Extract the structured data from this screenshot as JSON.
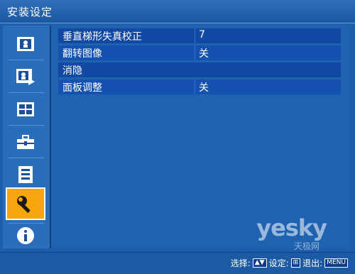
{
  "window": {
    "title": "安装设定"
  },
  "sidebar": {
    "items": [
      {
        "icon": "picture-icon",
        "active": false
      },
      {
        "icon": "picture-adjust-icon",
        "active": false
      },
      {
        "icon": "screen-split-icon",
        "active": false
      },
      {
        "icon": "toolbox-icon",
        "active": false
      },
      {
        "icon": "list-icon",
        "active": false
      },
      {
        "icon": "wrench-icon",
        "active": true
      },
      {
        "icon": "info-icon",
        "active": false
      }
    ]
  },
  "menu": {
    "rows": [
      {
        "label": "垂直梯形失真校正",
        "value": "7"
      },
      {
        "label": "翻转图像",
        "value": "关"
      },
      {
        "label": "消隐",
        "value": ""
      },
      {
        "label": "面板调整",
        "value": "关"
      }
    ]
  },
  "status": {
    "select_label": "选择:",
    "set_label": "设定:",
    "exit_label": "退出:",
    "menu_key": "MENU"
  },
  "watermark": {
    "logo": "yesky",
    "sub": "天极网"
  },
  "colors": {
    "background": "#1f5fa9",
    "active": "#f6a60d",
    "row": "#1348a3"
  }
}
